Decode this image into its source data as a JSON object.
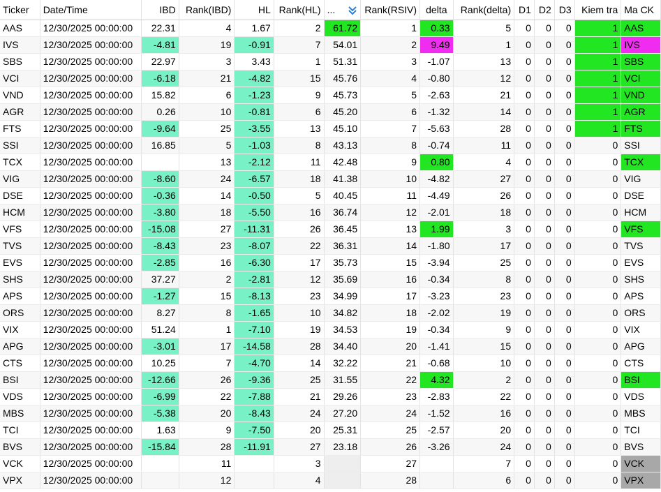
{
  "headers": [
    "Ticker",
    "Date/Time",
    "IBD",
    "Rank(IBD)",
    "HL",
    "Rank(HL)",
    "...",
    "Rank(RSIV)",
    "delta",
    "Rank(delta)",
    "D1",
    "D2",
    "D3",
    "Kiem tra",
    "Ma CK"
  ],
  "colors": {
    "aqua": "#78f1c6",
    "green": "#22e622",
    "magenta": "#f02cf0",
    "gray": "#a8a8a8"
  },
  "rows": [
    [
      "AAS",
      "12/30/2025 00:00:00",
      "22.31",
      "4",
      "1.67",
      "2",
      "61.72",
      "1",
      "0.33",
      "5",
      "0",
      "0",
      "0",
      "1",
      "AAS"
    ],
    [
      "IVS",
      "12/30/2025 00:00:00",
      "-4.81",
      "19",
      "-0.91",
      "7",
      "54.01",
      "2",
      "9.49",
      "1",
      "0",
      "0",
      "0",
      "1",
      "IVS"
    ],
    [
      "SBS",
      "12/30/2025 00:00:00",
      "22.97",
      "3",
      "3.43",
      "1",
      "51.31",
      "3",
      "-1.07",
      "13",
      "0",
      "0",
      "0",
      "1",
      "SBS"
    ],
    [
      "VCI",
      "12/30/2025 00:00:00",
      "-6.18",
      "21",
      "-4.82",
      "15",
      "45.76",
      "4",
      "-0.80",
      "12",
      "0",
      "0",
      "0",
      "1",
      "VCI"
    ],
    [
      "VND",
      "12/30/2025 00:00:00",
      "15.82",
      "6",
      "-1.23",
      "9",
      "45.73",
      "5",
      "-2.63",
      "21",
      "0",
      "0",
      "0",
      "1",
      "VND"
    ],
    [
      "AGR",
      "12/30/2025 00:00:00",
      "0.26",
      "10",
      "-0.81",
      "6",
      "45.20",
      "6",
      "-1.32",
      "14",
      "0",
      "0",
      "0",
      "1",
      "AGR"
    ],
    [
      "FTS",
      "12/30/2025 00:00:00",
      "-9.64",
      "25",
      "-3.55",
      "13",
      "45.10",
      "7",
      "-5.63",
      "28",
      "0",
      "0",
      "0",
      "1",
      "FTS"
    ],
    [
      "SSI",
      "12/30/2025 00:00:00",
      "16.85",
      "5",
      "-1.03",
      "8",
      "43.13",
      "8",
      "-0.74",
      "11",
      "0",
      "0",
      "0",
      "0",
      "SSI"
    ],
    [
      "TCX",
      "12/30/2025 00:00:00",
      "",
      "13",
      "-2.12",
      "11",
      "42.48",
      "9",
      "0.80",
      "4",
      "0",
      "0",
      "0",
      "0",
      "TCX"
    ],
    [
      "VIG",
      "12/30/2025 00:00:00",
      "-8.60",
      "24",
      "-6.57",
      "18",
      "41.38",
      "10",
      "-4.82",
      "27",
      "0",
      "0",
      "0",
      "0",
      "VIG"
    ],
    [
      "DSE",
      "12/30/2025 00:00:00",
      "-0.36",
      "14",
      "-0.50",
      "5",
      "40.45",
      "11",
      "-4.49",
      "26",
      "0",
      "0",
      "0",
      "0",
      "DSE"
    ],
    [
      "HCM",
      "12/30/2025 00:00:00",
      "-3.80",
      "18",
      "-5.50",
      "16",
      "36.74",
      "12",
      "-2.01",
      "18",
      "0",
      "0",
      "0",
      "0",
      "HCM"
    ],
    [
      "VFS",
      "12/30/2025 00:00:00",
      "-15.08",
      "27",
      "-11.31",
      "26",
      "36.45",
      "13",
      "1.99",
      "3",
      "0",
      "0",
      "0",
      "0",
      "VFS"
    ],
    [
      "TVS",
      "12/30/2025 00:00:00",
      "-8.43",
      "23",
      "-8.07",
      "22",
      "36.31",
      "14",
      "-1.80",
      "17",
      "0",
      "0",
      "0",
      "0",
      "TVS"
    ],
    [
      "EVS",
      "12/30/2025 00:00:00",
      "-2.85",
      "16",
      "-6.30",
      "17",
      "35.73",
      "15",
      "-3.94",
      "25",
      "0",
      "0",
      "0",
      "0",
      "EVS"
    ],
    [
      "SHS",
      "12/30/2025 00:00:00",
      "37.27",
      "2",
      "-2.81",
      "12",
      "35.69",
      "16",
      "-0.34",
      "8",
      "0",
      "0",
      "0",
      "0",
      "SHS"
    ],
    [
      "APS",
      "12/30/2025 00:00:00",
      "-1.27",
      "15",
      "-8.13",
      "23",
      "34.99",
      "17",
      "-3.23",
      "23",
      "0",
      "0",
      "0",
      "0",
      "APS"
    ],
    [
      "ORS",
      "12/30/2025 00:00:00",
      "8.27",
      "8",
      "-1.65",
      "10",
      "34.82",
      "18",
      "-2.02",
      "19",
      "0",
      "0",
      "0",
      "0",
      "ORS"
    ],
    [
      "VIX",
      "12/30/2025 00:00:00",
      "51.24",
      "1",
      "-7.10",
      "19",
      "34.53",
      "19",
      "-0.34",
      "9",
      "0",
      "0",
      "0",
      "0",
      "VIX"
    ],
    [
      "APG",
      "12/30/2025 00:00:00",
      "-3.01",
      "17",
      "-14.58",
      "28",
      "34.40",
      "20",
      "-1.41",
      "15",
      "0",
      "0",
      "0",
      "0",
      "APG"
    ],
    [
      "CTS",
      "12/30/2025 00:00:00",
      "10.25",
      "7",
      "-4.70",
      "14",
      "32.22",
      "21",
      "-0.68",
      "10",
      "0",
      "0",
      "0",
      "0",
      "CTS"
    ],
    [
      "BSI",
      "12/30/2025 00:00:00",
      "-12.66",
      "26",
      "-9.36",
      "25",
      "31.55",
      "22",
      "4.32",
      "2",
      "0",
      "0",
      "0",
      "0",
      "BSI"
    ],
    [
      "VDS",
      "12/30/2025 00:00:00",
      "-6.99",
      "22",
      "-7.88",
      "21",
      "29.26",
      "23",
      "-2.83",
      "22",
      "0",
      "0",
      "0",
      "0",
      "VDS"
    ],
    [
      "MBS",
      "12/30/2025 00:00:00",
      "-5.38",
      "20",
      "-8.43",
      "24",
      "27.20",
      "24",
      "-1.52",
      "16",
      "0",
      "0",
      "0",
      "0",
      "MBS"
    ],
    [
      "TCI",
      "12/30/2025 00:00:00",
      "1.63",
      "9",
      "-7.50",
      "20",
      "25.31",
      "25",
      "-2.57",
      "20",
      "0",
      "0",
      "0",
      "0",
      "TCI"
    ],
    [
      "BVS",
      "12/30/2025 00:00:00",
      "-15.84",
      "28",
      "-11.91",
      "27",
      "23.18",
      "26",
      "-3.26",
      "24",
      "0",
      "0",
      "0",
      "0",
      "BVS"
    ],
    [
      "VCK",
      "12/30/2025 00:00:00",
      "",
      "11",
      "",
      "3",
      "",
      "27",
      "",
      "7",
      "0",
      "0",
      "0",
      "0",
      "VCK"
    ],
    [
      "VPX",
      "12/30/2025 00:00:00",
      "",
      "12",
      "",
      "4",
      "",
      "28",
      "",
      "6",
      "0",
      "0",
      "0",
      "0",
      "VPX"
    ]
  ]
}
